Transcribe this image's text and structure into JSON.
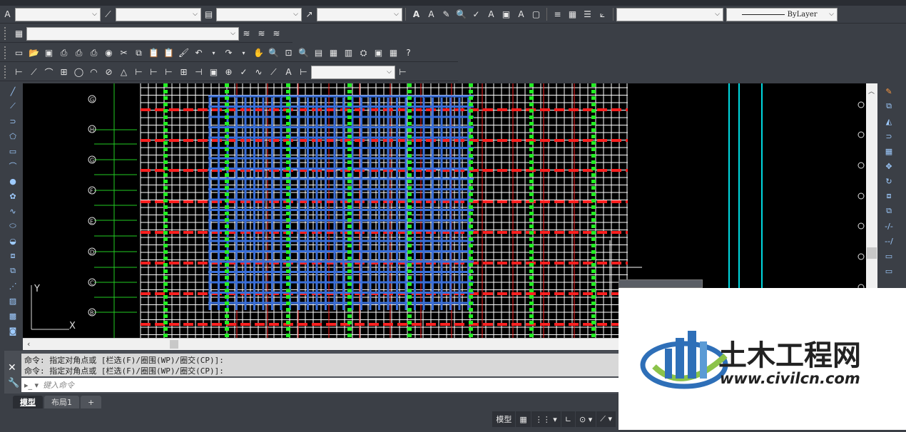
{
  "toolbar_props": {
    "linetype_label": "ByLayer"
  },
  "command": {
    "history": [
      "命令: 指定对角点或 [栏选(F)/圈围(WP)/圈交(CP)]:",
      "命令: 指定对角点或 [栏选(F)/圈围(WP)/圈交(CP)]:"
    ],
    "placeholder": "键入命令"
  },
  "tabs": [
    {
      "label": "模型",
      "active": true
    },
    {
      "label": "布局1",
      "active": false
    },
    {
      "label": "+",
      "active": false
    }
  ],
  "status": {
    "model_label": "模型"
  },
  "drawing": {
    "axis_labels": [
      "G",
      "H",
      "G",
      "F",
      "E",
      "D",
      "C",
      "B"
    ],
    "ucs_y": "Y",
    "ucs_x": "X"
  },
  "watermark": {
    "brand": "土木工程网",
    "url": "www.civilcn.com"
  },
  "colors": {
    "background": "#000000",
    "rebar_blue": "#3a6fd8",
    "dim_red": "#ff2020",
    "column_green": "#22ee22",
    "grid_white": "#ffffff",
    "cyan_line": "#00d8e0"
  }
}
